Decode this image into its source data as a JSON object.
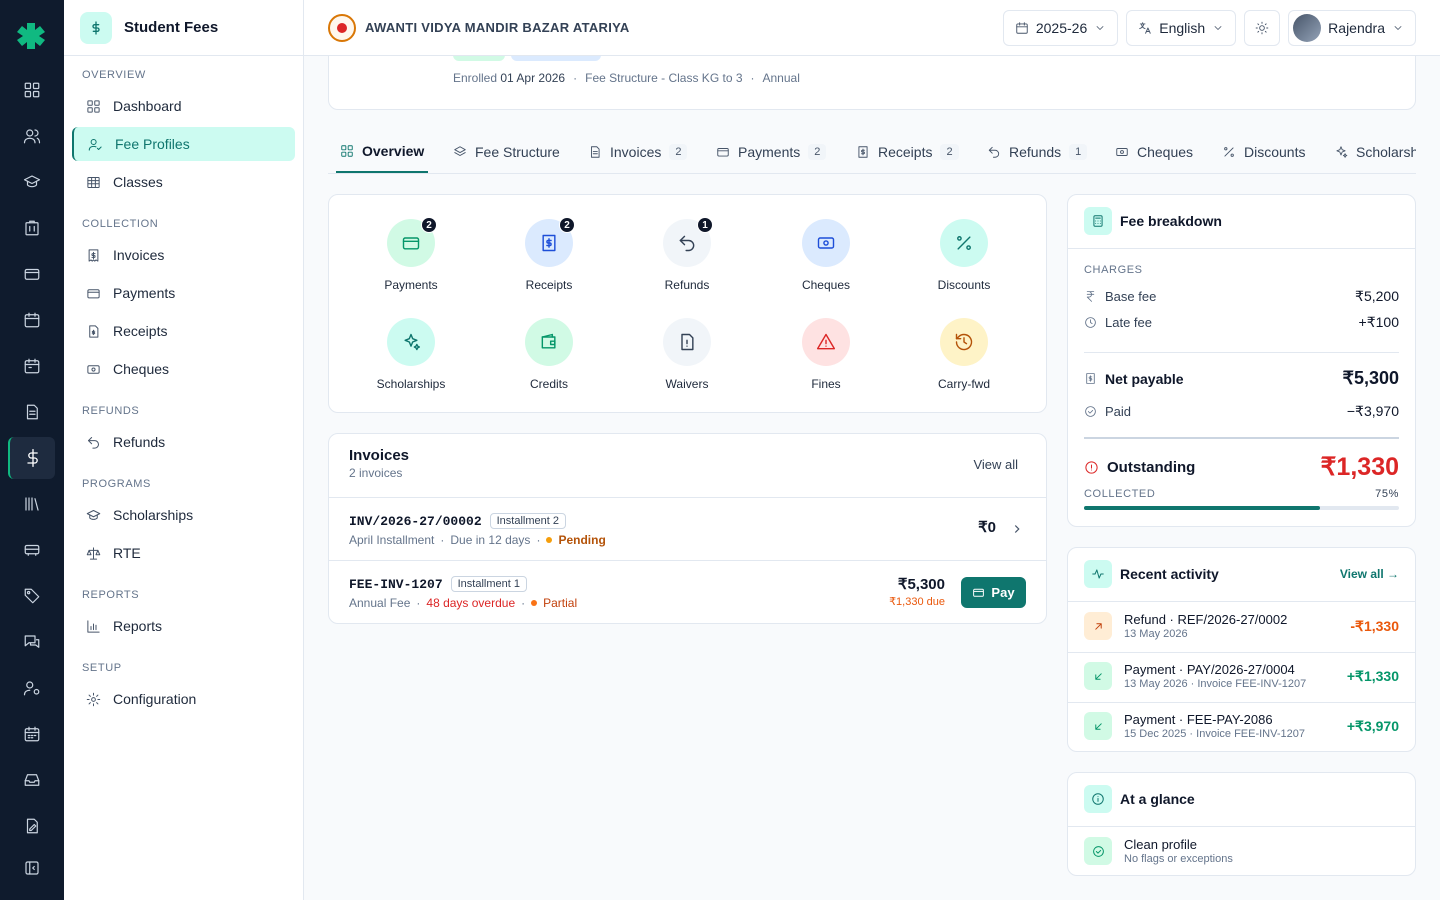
{
  "sidebar": {
    "title": "Student Fees",
    "sections": {
      "overview": "OVERVIEW",
      "collection": "COLLECTION",
      "refunds": "REFUNDS",
      "programs": "PROGRAMS",
      "reports": "REPORTS",
      "setup": "SETUP"
    },
    "items": {
      "dashboard": "Dashboard",
      "fee_profiles": "Fee Profiles",
      "classes": "Classes",
      "invoices": "Invoices",
      "payments": "Payments",
      "receipts": "Receipts",
      "cheques": "Cheques",
      "refunds": "Refunds",
      "scholarships": "Scholarships",
      "rte": "RTE",
      "reports": "Reports",
      "configuration": "Configuration"
    }
  },
  "topbar": {
    "school_name": "AWANTI VIDYA MANDIR BAZAR ATARIYA",
    "year": "2025-26",
    "language": "English",
    "user": "Rajendra"
  },
  "profile": {
    "enrolled_label": "Enrolled",
    "enrolled_date": "01 Apr 2026",
    "fee_structure": "Fee Structure - Class KG to 3",
    "frequency": "Annual"
  },
  "tabs": {
    "overview": "Overview",
    "fee_structure": "Fee Structure",
    "invoices": "Invoices",
    "invoices_count": "2",
    "payments": "Payments",
    "payments_count": "2",
    "receipts": "Receipts",
    "receipts_count": "2",
    "refunds": "Refunds",
    "refunds_count": "1",
    "cheques": "Cheques",
    "discounts": "Discounts",
    "scholarships": "Scholarshi"
  },
  "quick_actions": {
    "payments": "Payments",
    "payments_count": "2",
    "receipts": "Receipts",
    "receipts_count": "2",
    "refunds": "Refunds",
    "refunds_count": "1",
    "cheques": "Cheques",
    "discounts": "Discounts",
    "scholarships": "Scholarships",
    "credits": "Credits",
    "waivers": "Waivers",
    "fines": "Fines",
    "carry_fwd": "Carry-fwd"
  },
  "invoices": {
    "title": "Invoices",
    "subtitle": "2 invoices",
    "view_all": "View all",
    "rows": [
      {
        "number": "INV/2026-27/00002",
        "installment": "Installment 2",
        "name": "April Installment",
        "due": "Due in 12 days",
        "status": "Pending",
        "amount": "₹0"
      },
      {
        "number": "FEE-INV-1207",
        "installment": "Installment 1",
        "name": "Annual Fee",
        "due": "48 days overdue",
        "status": "Partial",
        "amount": "₹5,300",
        "due_amount": "₹1,330 due",
        "pay_label": "Pay"
      }
    ]
  },
  "fee_breakdown": {
    "title": "Fee breakdown",
    "charges_label": "CHARGES",
    "base_fee_label": "Base fee",
    "base_fee": "₹5,200",
    "late_fee_label": "Late fee",
    "late_fee": "+₹100",
    "net_payable_label": "Net payable",
    "net_payable": "₹5,300",
    "paid_label": "Paid",
    "paid": "−₹3,970",
    "outstanding_label": "Outstanding",
    "outstanding": "₹1,330",
    "collected_label": "COLLECTED",
    "collected_pct": "75%",
    "collected_fraction": 0.75
  },
  "recent_activity": {
    "title": "Recent activity",
    "view_all": "View all →",
    "items": [
      {
        "title": "Refund · REF/2026-27/0002",
        "sub": "13 May 2026",
        "amount": "-₹1,330"
      },
      {
        "title": "Payment · PAY/2026-27/0004",
        "sub": "13 May 2026 · Invoice FEE-INV-1207",
        "amount": "+₹1,330"
      },
      {
        "title": "Payment · FEE-PAY-2086",
        "sub": "15 Dec 2025 · Invoice FEE-INV-1207",
        "amount": "+₹3,970"
      }
    ]
  },
  "glance": {
    "title": "At a glance",
    "item_title": "Clean profile",
    "item_sub": "No flags or exceptions"
  },
  "colors": {
    "accent": "#0f766e",
    "rail_bg": "#0f1b2d",
    "danger": "#dc2626",
    "warning": "#ea580c",
    "success": "#059669"
  }
}
